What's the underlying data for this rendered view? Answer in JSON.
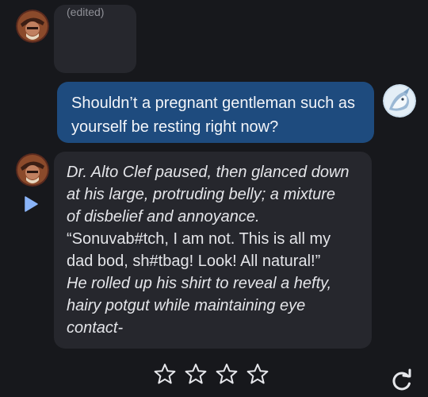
{
  "messages": [
    {
      "role": "assistant",
      "status": "(edited)",
      "avatar_icon": "character-avatar-icon"
    },
    {
      "role": "user",
      "text": "Shouldn’t a pregnant gentleman such as yourself be resting right now?",
      "avatar_icon": "user-avatar-icon"
    },
    {
      "role": "assistant",
      "avatar_icon": "character-avatar-icon",
      "lines": [
        {
          "style": "italic",
          "text": "Dr. Alto Clef paused, then glanced down"
        },
        {
          "style": "italic",
          "text": "at his large, protruding belly; a mixture"
        },
        {
          "style": "italic",
          "text": "of disbelief and annoyance."
        },
        {
          "style": "regular",
          "text": "“Sonuvab#tch, I am not. This is all my"
        },
        {
          "style": "regular",
          "text": "dad bod, sh#tbag! Look! All natural!”"
        },
        {
          "style": "italic",
          "text": "He rolled up his shirt to reveal a hefty,"
        },
        {
          "style": "italic",
          "text": "hairy potgut while maintaining eye"
        },
        {
          "style": "italic",
          "text": "contact-"
        }
      ]
    }
  ],
  "rating": {
    "max": 4,
    "value": 0
  },
  "icons": {
    "play": "play-icon",
    "star": "star-outline-icon",
    "refresh": "refresh-icon"
  },
  "colors": {
    "background": "#17181c",
    "bot_bubble": "#26272d",
    "user_bubble": "#1e4b7e",
    "accent": "#8ab4f8"
  }
}
